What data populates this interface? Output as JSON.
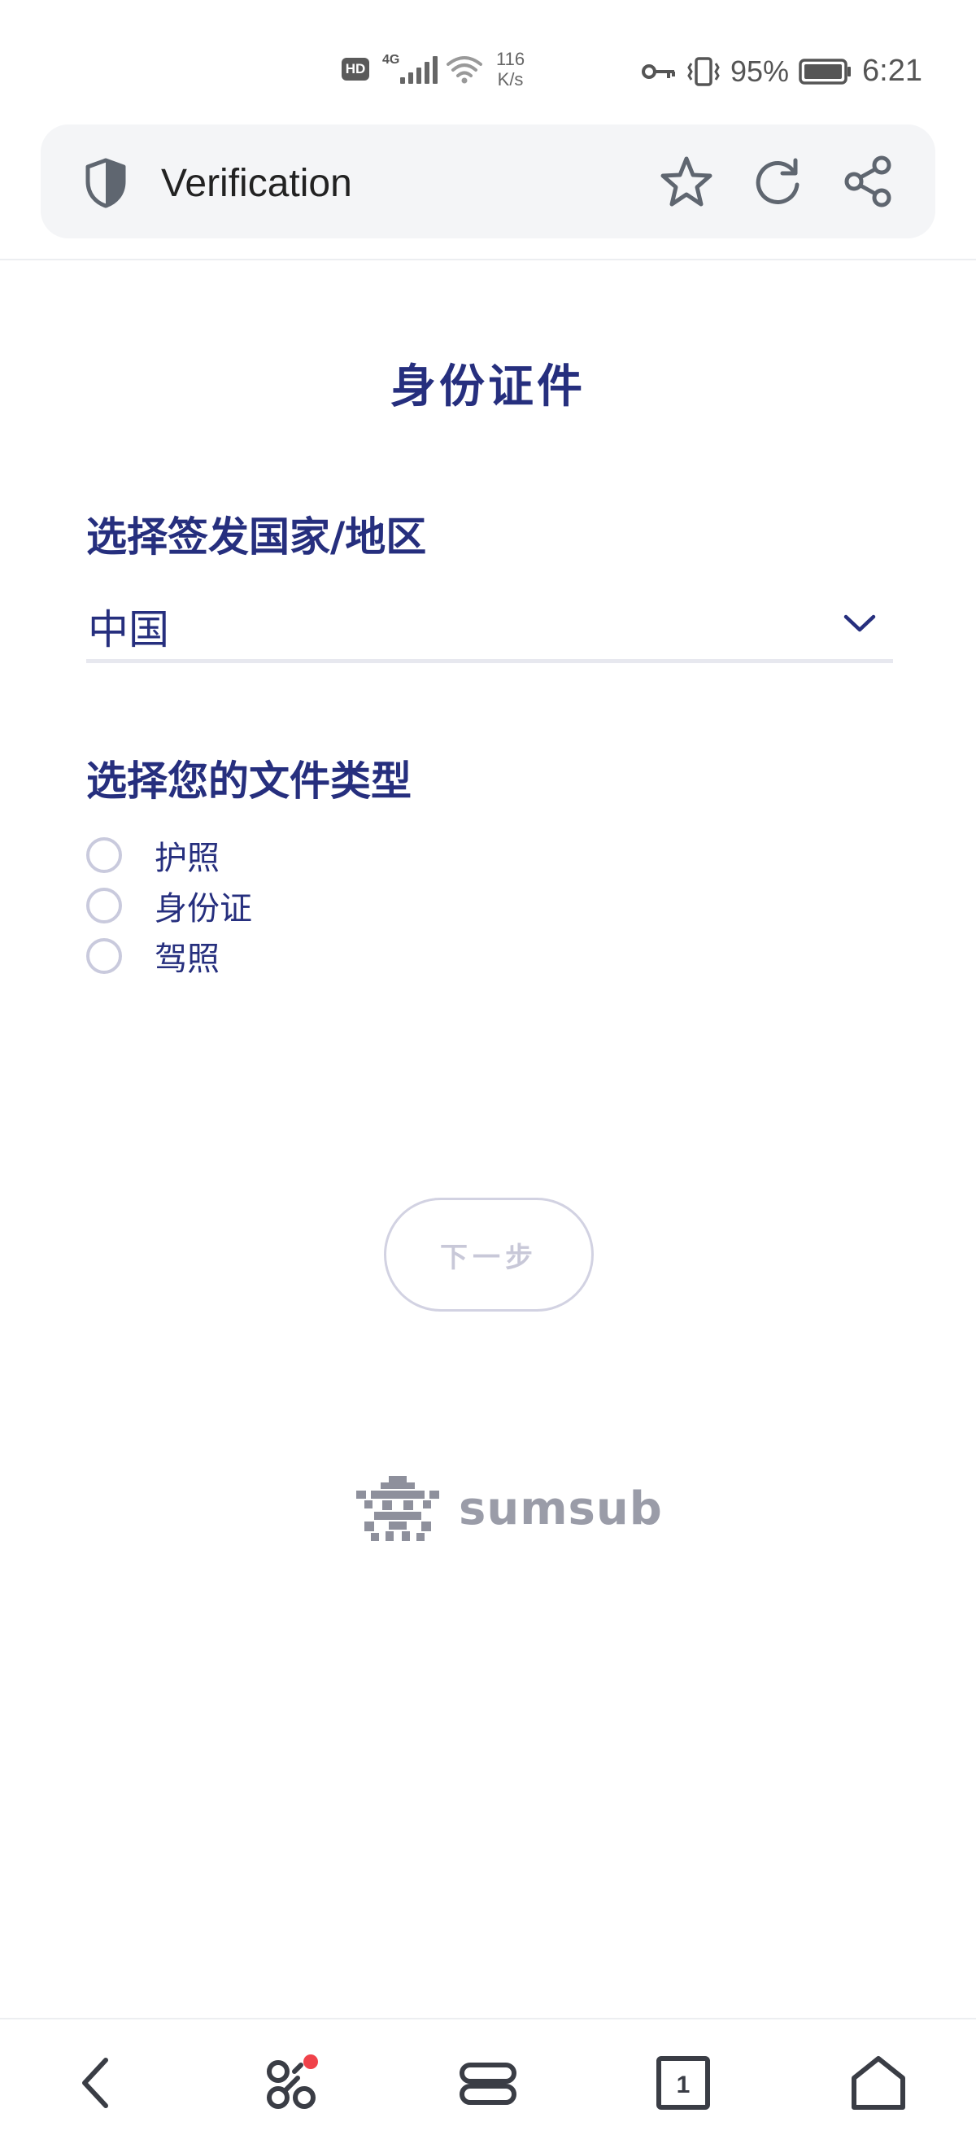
{
  "status_bar": {
    "network_badge": "HD",
    "network_gen": "4G",
    "speed_value": "116",
    "speed_unit": "K/s",
    "battery": "95%",
    "time": "6:21"
  },
  "browser": {
    "title": "Verification",
    "tab_count": "1"
  },
  "page": {
    "title": "身份证件",
    "country_label": "选择签发国家/地区",
    "country_value": "中国",
    "doctype_label": "选择您的文件类型",
    "doc_types": [
      {
        "label": "护照"
      },
      {
        "label": "身份证"
      },
      {
        "label": "驾照"
      }
    ],
    "next_button": "下一步"
  },
  "brand": {
    "name": "sumsub"
  },
  "icons": {
    "shield": "shield-icon",
    "star": "star-icon",
    "reload": "reload-icon",
    "share": "share-icon",
    "back": "chevron-left-icon",
    "apps": "apps-icon",
    "menu": "menu-icon",
    "tabs": "tabs-icon",
    "home": "home-icon"
  },
  "colors": {
    "primary_text": "#262f7e",
    "disabled": "#c8c8d8",
    "notification_dot": "#f0424a"
  }
}
